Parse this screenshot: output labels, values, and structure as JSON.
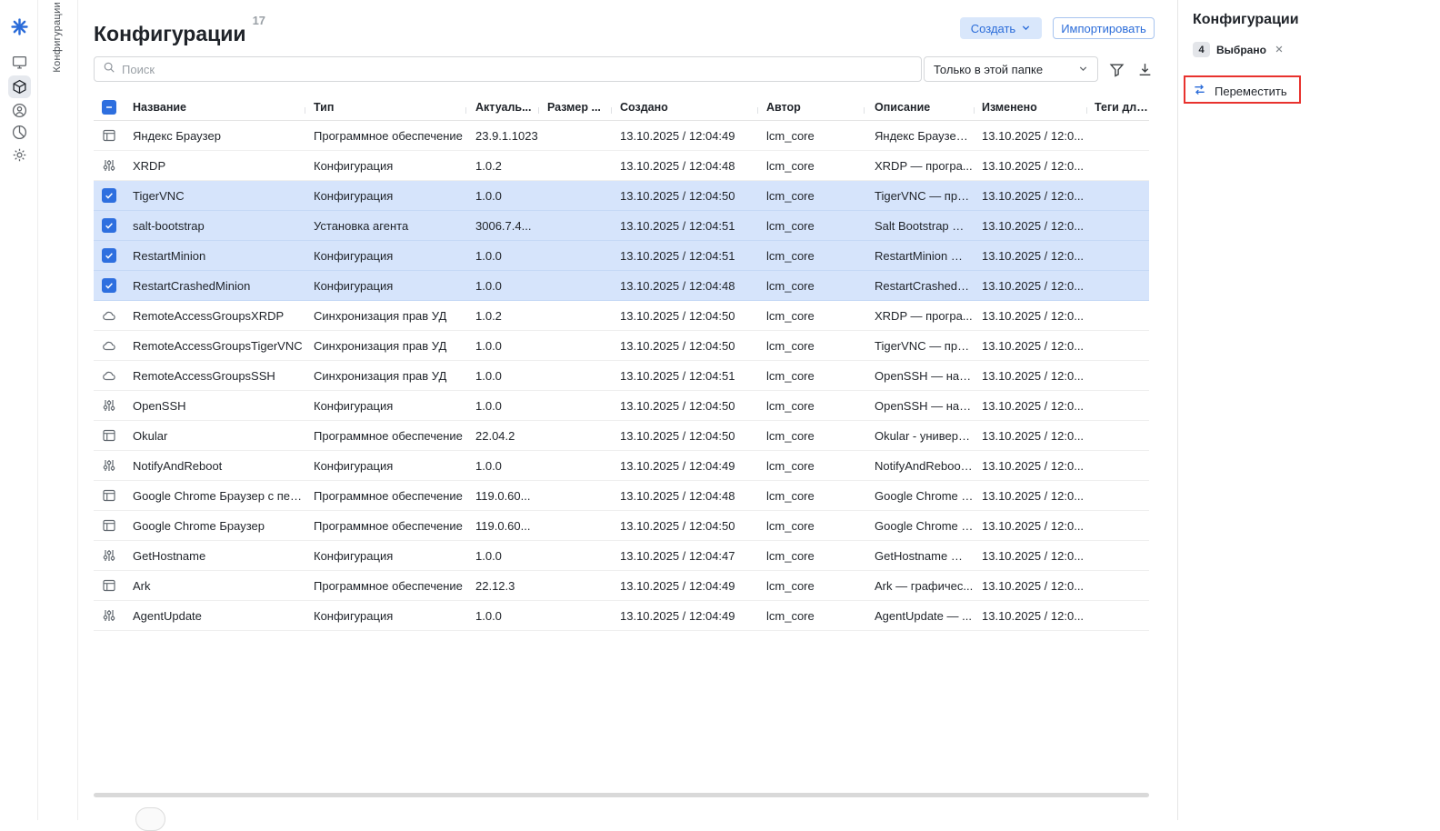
{
  "colors": {
    "accent": "#2b6cd9",
    "selected_row": "#d6e4fb",
    "annotation": "#e8322e"
  },
  "sidebar": {
    "vertical_label": "Конфигурации",
    "items": [
      {
        "icon": "monitor-icon",
        "active": false
      },
      {
        "icon": "package-icon",
        "active": true
      },
      {
        "icon": "user-icon",
        "active": false
      },
      {
        "icon": "pie-icon",
        "active": false
      },
      {
        "icon": "gear-icon",
        "active": false
      }
    ]
  },
  "header": {
    "title": "Конфигурации",
    "count": "17",
    "create_button": "Создать",
    "import_button": "Импортировать"
  },
  "toolbar": {
    "search_placeholder": "Поиск",
    "scope_filter": "Только в этой папке"
  },
  "table": {
    "columns": [
      "Название",
      "Тип",
      "Актуаль...",
      "Размер ...",
      "Создано",
      "Автор",
      "Описание",
      "Изменено",
      "Теги для..."
    ],
    "rows": [
      {
        "icon": "app-window-icon",
        "name": "Яндекс Браузер",
        "type": "Программное обеспечение",
        "version": "23.9.1.1023",
        "size": "",
        "created": "13.10.2025 / 12:04:49",
        "author": "lcm_core",
        "description": "Яндекс Браузер ...",
        "modified": "13.10.2025 / 12:0...",
        "tags": "",
        "selected": false
      },
      {
        "icon": "sliders-icon",
        "name": "XRDP",
        "type": "Конфигурация",
        "version": "1.0.2",
        "size": "",
        "created": "13.10.2025 / 12:04:48",
        "author": "lcm_core",
        "description": "XRDP — програ...",
        "modified": "13.10.2025 / 12:0...",
        "tags": "",
        "selected": false
      },
      {
        "icon": "sliders-icon",
        "name": "TigerVNC",
        "type": "Конфигурация",
        "version": "1.0.0",
        "size": "",
        "created": "13.10.2025 / 12:04:50",
        "author": "lcm_core",
        "description": "TigerVNC — про...",
        "modified": "13.10.2025 / 12:0...",
        "tags": "",
        "selected": true
      },
      {
        "icon": "sliders-icon",
        "name": "salt-bootstrap",
        "type": "Установка агента",
        "version": "3006.7.4...",
        "size": "",
        "created": "13.10.2025 / 12:04:51",
        "author": "lcm_core",
        "description": "Salt Bootstrap — ...",
        "modified": "13.10.2025 / 12:0...",
        "tags": "",
        "selected": true
      },
      {
        "icon": "sliders-icon",
        "name": "RestartMinion",
        "type": "Конфигурация",
        "version": "1.0.0",
        "size": "",
        "created": "13.10.2025 / 12:04:51",
        "author": "lcm_core",
        "description": "RestartMinion — ...",
        "modified": "13.10.2025 / 12:0...",
        "tags": "",
        "selected": true
      },
      {
        "icon": "sliders-icon",
        "name": "RestartCrashedMinion",
        "type": "Конфигурация",
        "version": "1.0.0",
        "size": "",
        "created": "13.10.2025 / 12:04:48",
        "author": "lcm_core",
        "description": "RestartCrashedM...",
        "modified": "13.10.2025 / 12:0...",
        "tags": "",
        "selected": true
      },
      {
        "icon": "cloud-icon",
        "name": "RemoteAccessGroupsXRDP",
        "type": "Синхронизация прав УД",
        "version": "1.0.2",
        "size": "",
        "created": "13.10.2025 / 12:04:50",
        "author": "lcm_core",
        "description": "XRDP — програ...",
        "modified": "13.10.2025 / 12:0...",
        "tags": "",
        "selected": false
      },
      {
        "icon": "cloud-icon",
        "name": "RemoteAccessGroupsTigerVNC",
        "type": "Синхронизация прав УД",
        "version": "1.0.0",
        "size": "",
        "created": "13.10.2025 / 12:04:50",
        "author": "lcm_core",
        "description": "TigerVNC — про...",
        "modified": "13.10.2025 / 12:0...",
        "tags": "",
        "selected": false
      },
      {
        "icon": "cloud-icon",
        "name": "RemoteAccessGroupsSSH",
        "type": "Синхронизация прав УД",
        "version": "1.0.0",
        "size": "",
        "created": "13.10.2025 / 12:04:51",
        "author": "lcm_core",
        "description": "OpenSSH — наб...",
        "modified": "13.10.2025 / 12:0...",
        "tags": "",
        "selected": false
      },
      {
        "icon": "sliders-icon",
        "name": "OpenSSH",
        "type": "Конфигурация",
        "version": "1.0.0",
        "size": "",
        "created": "13.10.2025 / 12:04:50",
        "author": "lcm_core",
        "description": "OpenSSH — наб...",
        "modified": "13.10.2025 / 12:0...",
        "tags": "",
        "selected": false
      },
      {
        "icon": "app-window-icon",
        "name": "Okular",
        "type": "Программное обеспечение",
        "version": "22.04.2",
        "size": "",
        "created": "13.10.2025 / 12:04:50",
        "author": "lcm_core",
        "description": "Okular - универс...",
        "modified": "13.10.2025 / 12:0...",
        "tags": "",
        "selected": false
      },
      {
        "icon": "sliders-icon",
        "name": "NotifyAndReboot",
        "type": "Конфигурация",
        "version": "1.0.0",
        "size": "",
        "created": "13.10.2025 / 12:04:49",
        "author": "lcm_core",
        "description": "NotifyAndReboot ...",
        "modified": "13.10.2025 / 12:0...",
        "tags": "",
        "selected": false
      },
      {
        "icon": "app-window-icon",
        "name": "Google Chrome Браузер с перез...",
        "type": "Программное обеспечение",
        "version": "119.0.60...",
        "size": "",
        "created": "13.10.2025 / 12:04:48",
        "author": "lcm_core",
        "description": "Google Chrome –...",
        "modified": "13.10.2025 / 12:0...",
        "tags": "",
        "selected": false
      },
      {
        "icon": "app-window-icon",
        "name": "Google Chrome Браузер",
        "type": "Программное обеспечение",
        "version": "119.0.60...",
        "size": "",
        "created": "13.10.2025 / 12:04:50",
        "author": "lcm_core",
        "description": "Google Chrome –...",
        "modified": "13.10.2025 / 12:0...",
        "tags": "",
        "selected": false
      },
      {
        "icon": "sliders-icon",
        "name": "GetHostname",
        "type": "Конфигурация",
        "version": "1.0.0",
        "size": "",
        "created": "13.10.2025 / 12:04:47",
        "author": "lcm_core",
        "description": "GetHostname — ...",
        "modified": "13.10.2025 / 12:0...",
        "tags": "",
        "selected": false
      },
      {
        "icon": "app-window-icon",
        "name": "Ark",
        "type": "Программное обеспечение",
        "version": "22.12.3",
        "size": "",
        "created": "13.10.2025 / 12:04:49",
        "author": "lcm_core",
        "description": "Ark — графичес...",
        "modified": "13.10.2025 / 12:0...",
        "tags": "",
        "selected": false
      },
      {
        "icon": "sliders-icon",
        "name": "AgentUpdate",
        "type": "Конфигурация",
        "version": "1.0.0",
        "size": "",
        "created": "13.10.2025 / 12:04:49",
        "author": "lcm_core",
        "description": "AgentUpdate — ...",
        "modified": "13.10.2025 / 12:0...",
        "tags": "",
        "selected": false
      }
    ]
  },
  "right_panel": {
    "title": "Конфигурации",
    "selected_count": "4",
    "selected_label": "Выбрано",
    "move_button": "Переместить"
  }
}
